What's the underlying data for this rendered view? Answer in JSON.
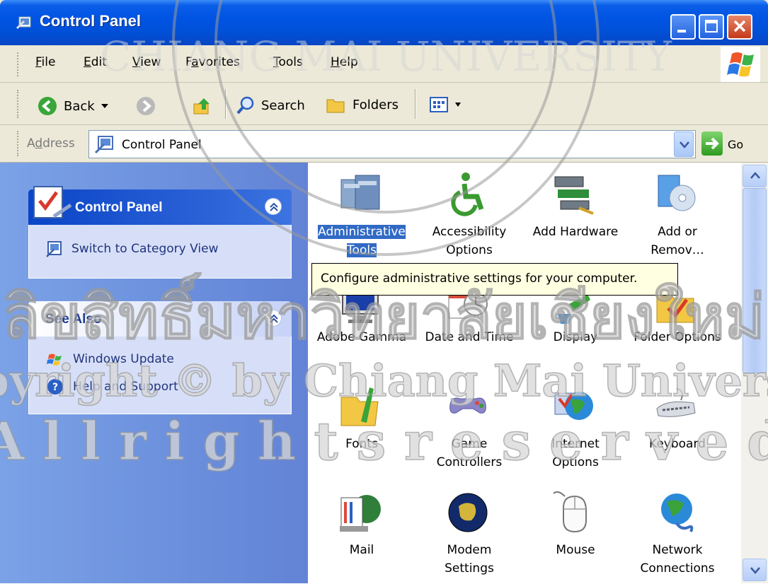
{
  "window": {
    "title": "Control Panel",
    "colors": {
      "titlebar": "#0054e3",
      "task_pane": "#6b8fdc",
      "selection": "#316ac5",
      "tooltip_bg": "#ffffe1"
    }
  },
  "menu": {
    "items": [
      {
        "u": "F",
        "rest": "ile"
      },
      {
        "u": "E",
        "rest": "dit"
      },
      {
        "u": "V",
        "rest": "iew"
      },
      {
        "pre": "F",
        "u": "a",
        "rest": "vorites"
      },
      {
        "u": "T",
        "rest": "ools"
      },
      {
        "u": "H",
        "rest": "elp"
      }
    ]
  },
  "toolbar": {
    "back": "Back",
    "search": "Search",
    "folders": "Folders"
  },
  "address": {
    "label_pre": "A",
    "label_u": "d",
    "label_rest": "dress",
    "value": "Control Panel",
    "go": "Go"
  },
  "sidebar": {
    "control_panel": {
      "title": "Control Panel",
      "link": "Switch to Category View"
    },
    "see_also": {
      "title": "See Also",
      "links": [
        "Windows Update",
        "Help and Support"
      ]
    }
  },
  "items": [
    {
      "name": "Administrative Tools",
      "line1": "Administrative",
      "line2": "Tools",
      "icon": "admin-tools-icon",
      "selected": true
    },
    {
      "name": "Accessibility Options",
      "line1": "Accessibility",
      "line2": "Options",
      "icon": "accessibility-icon"
    },
    {
      "name": "Add Hardware",
      "line1": "Add Hardware",
      "line2": "",
      "icon": "add-hardware-icon"
    },
    {
      "name": "Add or Remove",
      "line1": "Add or",
      "line2": "Remov…",
      "icon": "add-remove-programs-icon"
    },
    {
      "name": "Adobe Gamma",
      "line1": "Adobe Gamma",
      "line2": "",
      "icon": "adobe-gamma-icon"
    },
    {
      "name": "Date and Time",
      "line1": "Date and Time",
      "line2": "",
      "icon": "date-time-icon"
    },
    {
      "name": "Display",
      "line1": "Display",
      "line2": "",
      "icon": "display-icon"
    },
    {
      "name": "Folder Options",
      "line1": "Folder Options",
      "line2": "",
      "icon": "folder-options-icon"
    },
    {
      "name": "Fonts",
      "line1": "Fonts",
      "line2": "",
      "icon": "fonts-icon"
    },
    {
      "name": "Game Controllers",
      "line1": "Game",
      "line2": "Controllers",
      "icon": "game-controllers-icon"
    },
    {
      "name": "Internet Options",
      "line1": "Internet",
      "line2": "Options",
      "icon": "internet-options-icon"
    },
    {
      "name": "Keyboard",
      "line1": "Keyboard",
      "line2": "",
      "icon": "keyboard-icon"
    },
    {
      "name": "Mail",
      "line1": "Mail",
      "line2": "",
      "icon": "mail-icon"
    },
    {
      "name": "Modem Settings",
      "line1": "Modem",
      "line2": "Settings",
      "icon": "modem-icon"
    },
    {
      "name": "Mouse",
      "line1": "Mouse",
      "line2": "",
      "icon": "mouse-icon"
    },
    {
      "name": "Network Connections",
      "line1": "Network",
      "line2": "Connections",
      "icon": "network-icon"
    }
  ],
  "tooltip": "Configure administrative settings for your computer.",
  "watermark": {
    "lines": [
      "ลิขสิทธิ์มหาวิทยาลัยเชียงใหม่",
      "Copyright © by Chiang Mai University",
      "A l l   r i g h t s   r e s e r v e d"
    ],
    "seal_text": "CHIANG MAI UNIVERSITY"
  }
}
